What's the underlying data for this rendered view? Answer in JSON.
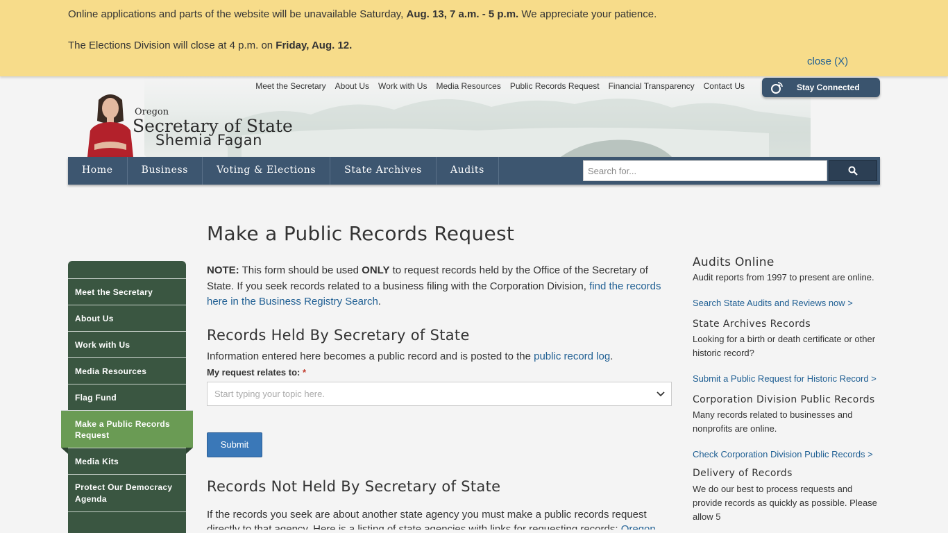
{
  "alert": {
    "line1_prefix": "Online applications and parts of the website will be unavailable Saturday, ",
    "line1_bold": "Aug. 13, 7 a.m. - 5 p.m.",
    "line1_suffix": " We appreciate your patience.",
    "line2_prefix": "The Elections Division will close at 4 p.m. on ",
    "line2_bold": "Friday, Aug. 12.",
    "close_label": "close (X)"
  },
  "header": {
    "utility_links": [
      "Meet the Secretary",
      "About Us",
      "Work with Us",
      "Media Resources",
      "Public Records Request",
      "Financial Transparency",
      "Contact Us"
    ],
    "stay_connected": "Stay Connected",
    "logo": {
      "state": "Oregon",
      "office": "Secretary of State",
      "name": "Shemia Fagan"
    }
  },
  "nav": {
    "items": [
      "Home",
      "Business",
      "Voting & Elections",
      "State Archives",
      "Audits"
    ],
    "search_placeholder": "Search for..."
  },
  "sidebar": {
    "items": [
      "Meet the Secretary",
      "About Us",
      "Work with Us",
      "Media Resources",
      "Flag Fund",
      "Make a Public Records Request",
      "Media Kits",
      "Protect Our Democracy Agenda"
    ],
    "active": "Make a Public Records Request"
  },
  "main": {
    "title": "Make a Public Records Request",
    "note_label": "NOTE:",
    "note_text1": " This form should be used ",
    "note_only": "ONLY",
    "note_text2": " to request records held by the Office of the Secretary of State. If you seek records related to a business filing with the Corporation Division, ",
    "note_link": "find the records here in the Business Registry Search",
    "note_end": ".",
    "section1_title": "Records Held By Secretary of State",
    "info_text": "Information entered here becomes a public record and is posted to the ",
    "info_link": "public record log",
    "info_end": ".",
    "field_label": "My request relates to:",
    "field_required": "*",
    "field_placeholder": "Start typing your topic here.",
    "submit_label": "Submit",
    "section2_title": "Records Not Held By Secretary of State",
    "section2_text": "If the records you seek are about another state agency you must make a public records request directly to that agency. Here is a listing of state agencies with links for requesting records: ",
    "section2_link": "Oregon"
  },
  "right": {
    "audits_title": "Audits Online",
    "audits_text": "Audit reports from 1997 to present are online.",
    "audits_link": "Search State Audits and Reviews now >",
    "archives_title": "State Archives Records",
    "archives_text": "Looking for a birth or death certificate or other historic record?",
    "archives_link": "Submit a Public Request for Historic Record >",
    "corp_title": "Corporation Division Public Records",
    "corp_text": "Many records related to businesses and nonprofits are online.",
    "corp_link": "Check Corporation Division Public Records >",
    "delivery_title": "Delivery of Records",
    "delivery_text": "We do our best to process requests and provide records as quickly as possible. Please allow 5"
  },
  "colors": {
    "alert_bg": "#f7dc8a",
    "nav_bg": "#3d5670",
    "sidebar_bg": "#3a5641",
    "sidebar_active": "#6a9b54",
    "link": "#1f5f93",
    "submit_bg": "#3a78b8"
  }
}
